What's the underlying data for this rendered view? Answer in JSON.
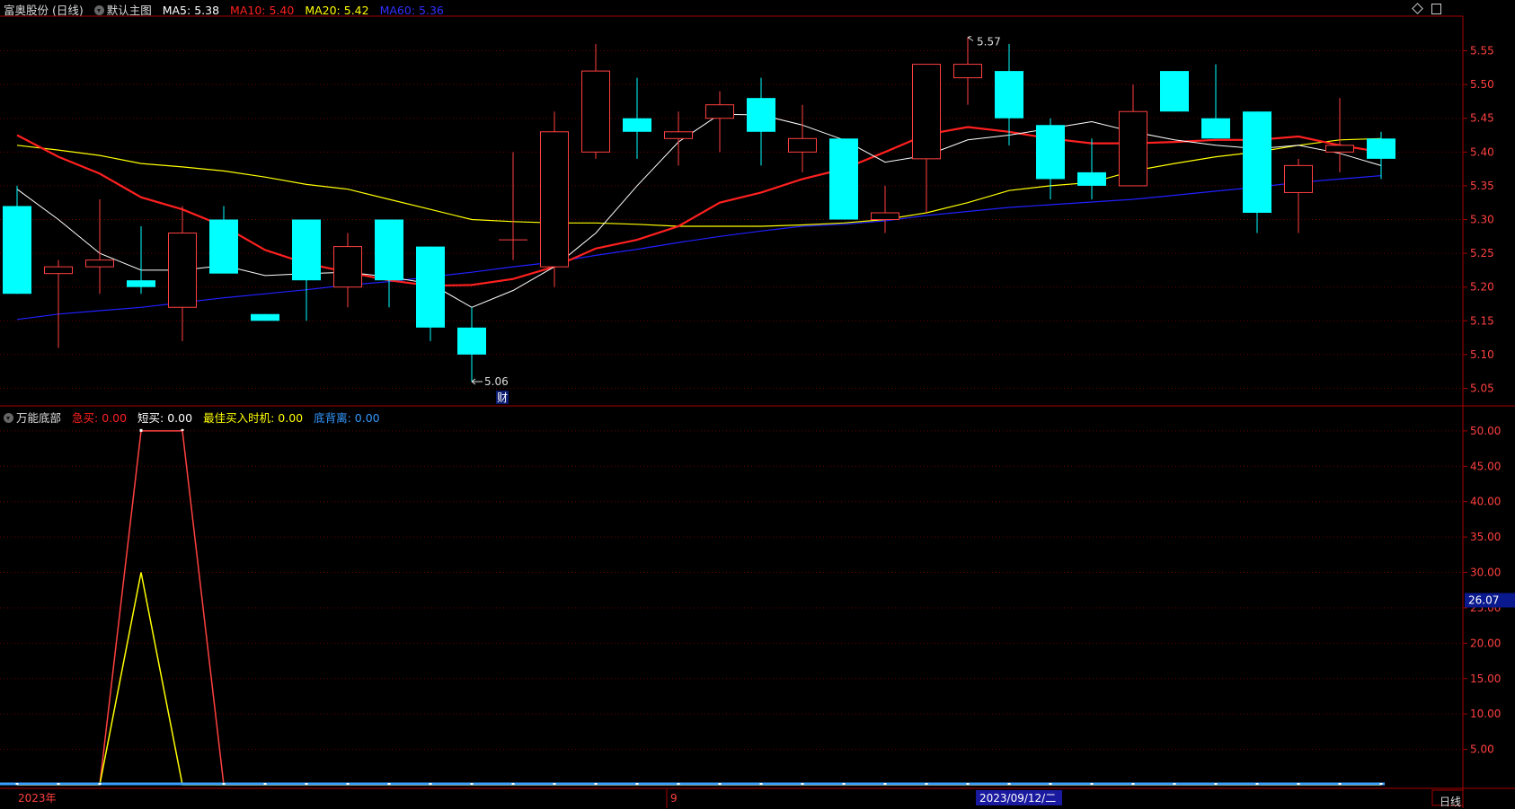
{
  "header": {
    "stock_name": "富奥股份 (日线)",
    "main_chart_label": "默认主图",
    "ma5_label": "MA5:",
    "ma5_value": "5.38",
    "ma10_label": "MA10:",
    "ma10_value": "5.40",
    "ma20_label": "MA20:",
    "ma20_value": "5.42",
    "ma60_label": "MA60:",
    "ma60_value": "5.36"
  },
  "indicator_header": {
    "name": "万能底部",
    "s1_label": "急买:",
    "s1_value": "0.00",
    "s2_label": "短买:",
    "s2_value": "0.00",
    "s3_label": "最佳买入时机:",
    "s3_value": "0.00",
    "s4_label": "底背离:",
    "s4_value": "0.00"
  },
  "colors": {
    "up": "#ff4040",
    "down": "#00ffff",
    "ma5": "#ffffff",
    "ma10": "#ff2020",
    "ma20": "#ffff00",
    "ma60": "#2020ff",
    "grid": "#6a0000",
    "axis": "#aa0000"
  },
  "annotations": {
    "high_label": "5.57",
    "low_label": "5.06",
    "finance_marker": "财"
  },
  "x_axis": {
    "year_label": "2023年",
    "month_label": "9",
    "cursor_date": "2023/09/12/二"
  },
  "period_label": "日线",
  "chart_data": [
    {
      "type": "candlestick",
      "title": "富奥股份 (日线)",
      "y_ticks": [
        "5.55",
        "5.50",
        "5.45",
        "5.40",
        "5.35",
        "5.30",
        "5.25",
        "5.20",
        "5.15",
        "5.10",
        "5.05"
      ],
      "ylim": [
        5.04,
        5.58
      ],
      "candles": [
        {
          "o": 5.32,
          "h": 5.35,
          "l": 5.19,
          "c": 5.19
        },
        {
          "o": 5.22,
          "h": 5.24,
          "l": 5.11,
          "c": 5.23
        },
        {
          "o": 5.23,
          "h": 5.33,
          "l": 5.19,
          "c": 5.24
        },
        {
          "o": 5.21,
          "h": 5.29,
          "l": 5.19,
          "c": 5.2
        },
        {
          "o": 5.17,
          "h": 5.32,
          "l": 5.12,
          "c": 5.28
        },
        {
          "o": 5.3,
          "h": 5.32,
          "l": 5.22,
          "c": 5.22
        },
        {
          "o": 5.16,
          "h": 5.16,
          "l": 5.15,
          "c": 5.15
        },
        {
          "o": 5.3,
          "h": 5.3,
          "l": 5.15,
          "c": 5.21
        },
        {
          "o": 5.2,
          "h": 5.28,
          "l": 5.17,
          "c": 5.26
        },
        {
          "o": 5.3,
          "h": 5.3,
          "l": 5.17,
          "c": 5.21
        },
        {
          "o": 5.26,
          "h": 5.26,
          "l": 5.12,
          "c": 5.14
        },
        {
          "o": 5.14,
          "h": 5.17,
          "l": 5.06,
          "c": 5.1
        },
        {
          "o": 5.27,
          "h": 5.4,
          "l": 5.24,
          "c": 5.27
        },
        {
          "o": 5.23,
          "h": 5.46,
          "l": 5.2,
          "c": 5.43
        },
        {
          "o": 5.4,
          "h": 5.56,
          "l": 5.39,
          "c": 5.52
        },
        {
          "o": 5.45,
          "h": 5.51,
          "l": 5.39,
          "c": 5.43
        },
        {
          "o": 5.42,
          "h": 5.46,
          "l": 5.38,
          "c": 5.43
        },
        {
          "o": 5.45,
          "h": 5.49,
          "l": 5.4,
          "c": 5.47
        },
        {
          "o": 5.48,
          "h": 5.51,
          "l": 5.38,
          "c": 5.43
        },
        {
          "o": 5.4,
          "h": 5.47,
          "l": 5.37,
          "c": 5.42
        },
        {
          "o": 5.42,
          "h": 5.42,
          "l": 5.3,
          "c": 5.3
        },
        {
          "o": 5.3,
          "h": 5.35,
          "l": 5.28,
          "c": 5.31
        },
        {
          "o": 5.39,
          "h": 5.53,
          "l": 5.31,
          "c": 5.53
        },
        {
          "o": 5.51,
          "h": 5.57,
          "l": 5.47,
          "c": 5.53
        },
        {
          "o": 5.52,
          "h": 5.56,
          "l": 5.41,
          "c": 5.45
        },
        {
          "o": 5.44,
          "h": 5.45,
          "l": 5.33,
          "c": 5.36
        },
        {
          "o": 5.37,
          "h": 5.42,
          "l": 5.33,
          "c": 5.35
        },
        {
          "o": 5.35,
          "h": 5.5,
          "l": 5.35,
          "c": 5.46
        },
        {
          "o": 5.52,
          "h": 5.52,
          "l": 5.46,
          "c": 5.46
        },
        {
          "o": 5.45,
          "h": 5.53,
          "l": 5.42,
          "c": 5.42
        },
        {
          "o": 5.46,
          "h": 5.46,
          "l": 5.28,
          "c": 5.31
        },
        {
          "o": 5.34,
          "h": 5.39,
          "l": 5.28,
          "c": 5.38
        },
        {
          "o": 5.4,
          "h": 5.48,
          "l": 5.37,
          "c": 5.41
        },
        {
          "o": 5.42,
          "h": 5.43,
          "l": 5.36,
          "c": 5.39
        }
      ],
      "series": [
        {
          "name": "MA5",
          "values": [
            5.345,
            5.3,
            5.25,
            5.225,
            5.225,
            5.232,
            5.217,
            5.22,
            5.222,
            5.215,
            5.205,
            5.17,
            5.195,
            5.23,
            5.28,
            5.35,
            5.415,
            5.456,
            5.455,
            5.44,
            5.418,
            5.385,
            5.395,
            5.418,
            5.425,
            5.435,
            5.445,
            5.43,
            5.418,
            5.41,
            5.405,
            5.41,
            5.398,
            5.38
          ]
        },
        {
          "name": "MA10",
          "values": [
            5.425,
            5.393,
            5.368,
            5.333,
            5.315,
            5.29,
            5.255,
            5.235,
            5.222,
            5.21,
            5.202,
            5.203,
            5.212,
            5.23,
            5.257,
            5.27,
            5.29,
            5.325,
            5.34,
            5.36,
            5.375,
            5.4,
            5.426,
            5.437,
            5.43,
            5.42,
            5.413,
            5.413,
            5.415,
            5.418,
            5.418,
            5.423,
            5.41,
            5.4
          ]
        },
        {
          "name": "MA20",
          "values": [
            5.41,
            5.403,
            5.395,
            5.383,
            5.378,
            5.372,
            5.363,
            5.352,
            5.345,
            5.33,
            5.315,
            5.3,
            5.297,
            5.295,
            5.295,
            5.293,
            5.29,
            5.29,
            5.29,
            5.292,
            5.295,
            5.3,
            5.31,
            5.325,
            5.343,
            5.35,
            5.355,
            5.372,
            5.383,
            5.393,
            5.4,
            5.41,
            5.418,
            5.42
          ]
        },
        {
          "name": "MA60",
          "values": [
            5.152,
            5.16,
            5.165,
            5.17,
            5.177,
            5.184,
            5.19,
            5.196,
            5.203,
            5.208,
            5.215,
            5.222,
            5.23,
            5.237,
            5.247,
            5.256,
            5.266,
            5.275,
            5.283,
            5.29,
            5.293,
            5.298,
            5.306,
            5.312,
            5.318,
            5.322,
            5.326,
            5.33,
            5.336,
            5.342,
            5.348,
            5.355,
            5.36,
            5.365
          ]
        }
      ]
    },
    {
      "type": "line",
      "title": "万能底部",
      "y_ticks": [
        "50.00",
        "45.00",
        "40.00",
        "35.00",
        "30.00",
        "25.00",
        "20.00",
        "15.00",
        "10.00",
        "5.00"
      ],
      "ylim": [
        0,
        51
      ],
      "current_value": "26.07",
      "series": [
        {
          "name": "急买",
          "values": [
            0,
            0,
            0,
            50,
            50,
            0,
            0,
            0,
            0,
            0,
            0,
            0,
            0,
            0,
            0,
            0,
            0,
            0,
            0,
            0,
            0,
            0,
            0,
            0,
            0,
            0,
            0,
            0,
            0,
            0,
            0,
            0,
            0,
            0
          ]
        },
        {
          "name": "最佳买入时机",
          "values": [
            0,
            0,
            0,
            30,
            0,
            0,
            0,
            0,
            0,
            0,
            0,
            0,
            0,
            0,
            0,
            0,
            0,
            0,
            0,
            0,
            0,
            0,
            0,
            0,
            0,
            0,
            0,
            0,
            0,
            0,
            0,
            0,
            0,
            0
          ]
        }
      ]
    }
  ]
}
